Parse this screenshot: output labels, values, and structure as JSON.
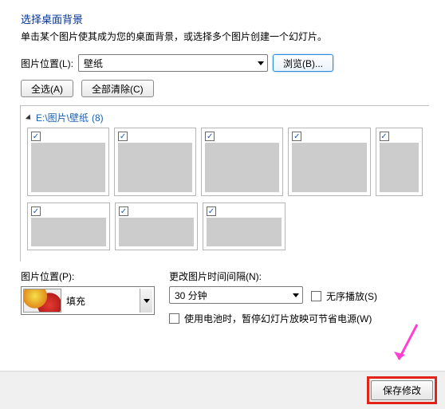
{
  "header": {
    "title": "选择桌面背景",
    "subtitle": "单击某个图片使其成为您的桌面背景，或选择多个图片创建一个幻灯片。"
  },
  "location": {
    "label": "图片位置(L):",
    "value": "壁纸",
    "browse": "浏览(B)..."
  },
  "selection": {
    "select_all": "全选(A)",
    "clear_all": "全部清除(C)"
  },
  "folder": {
    "path": "E:\\图片\\壁纸",
    "count": "(8)"
  },
  "position": {
    "label": "图片位置(P):",
    "value": "填充"
  },
  "interval": {
    "label": "更改图片时间间隔(N):",
    "value": "30 分钟",
    "shuffle": "无序播放(S)",
    "battery": "使用电池时，暂停幻灯片放映可节省电源(W)"
  },
  "footer": {
    "save": "保存修改"
  }
}
